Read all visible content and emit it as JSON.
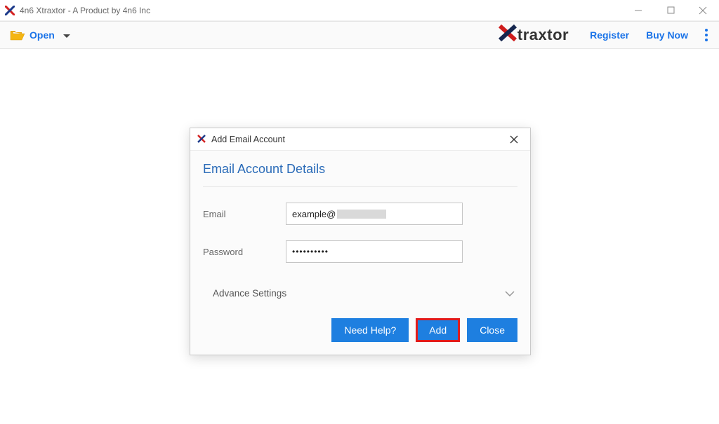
{
  "window": {
    "title": "4n6 Xtraxtor - A Product by 4n6 Inc"
  },
  "toolbar": {
    "open_label": "Open",
    "register_label": "Register",
    "buy_label": "Buy Now",
    "logo_text": "traxtor"
  },
  "dialog": {
    "title": "Add Email Account",
    "section_title": "Email Account Details",
    "email_label": "Email",
    "email_value_prefix": "example@",
    "password_label": "Password",
    "password_masked": "••••••••••",
    "advance_label": "Advance Settings",
    "need_help_label": "Need Help?",
    "add_label": "Add",
    "close_label": "Close"
  }
}
